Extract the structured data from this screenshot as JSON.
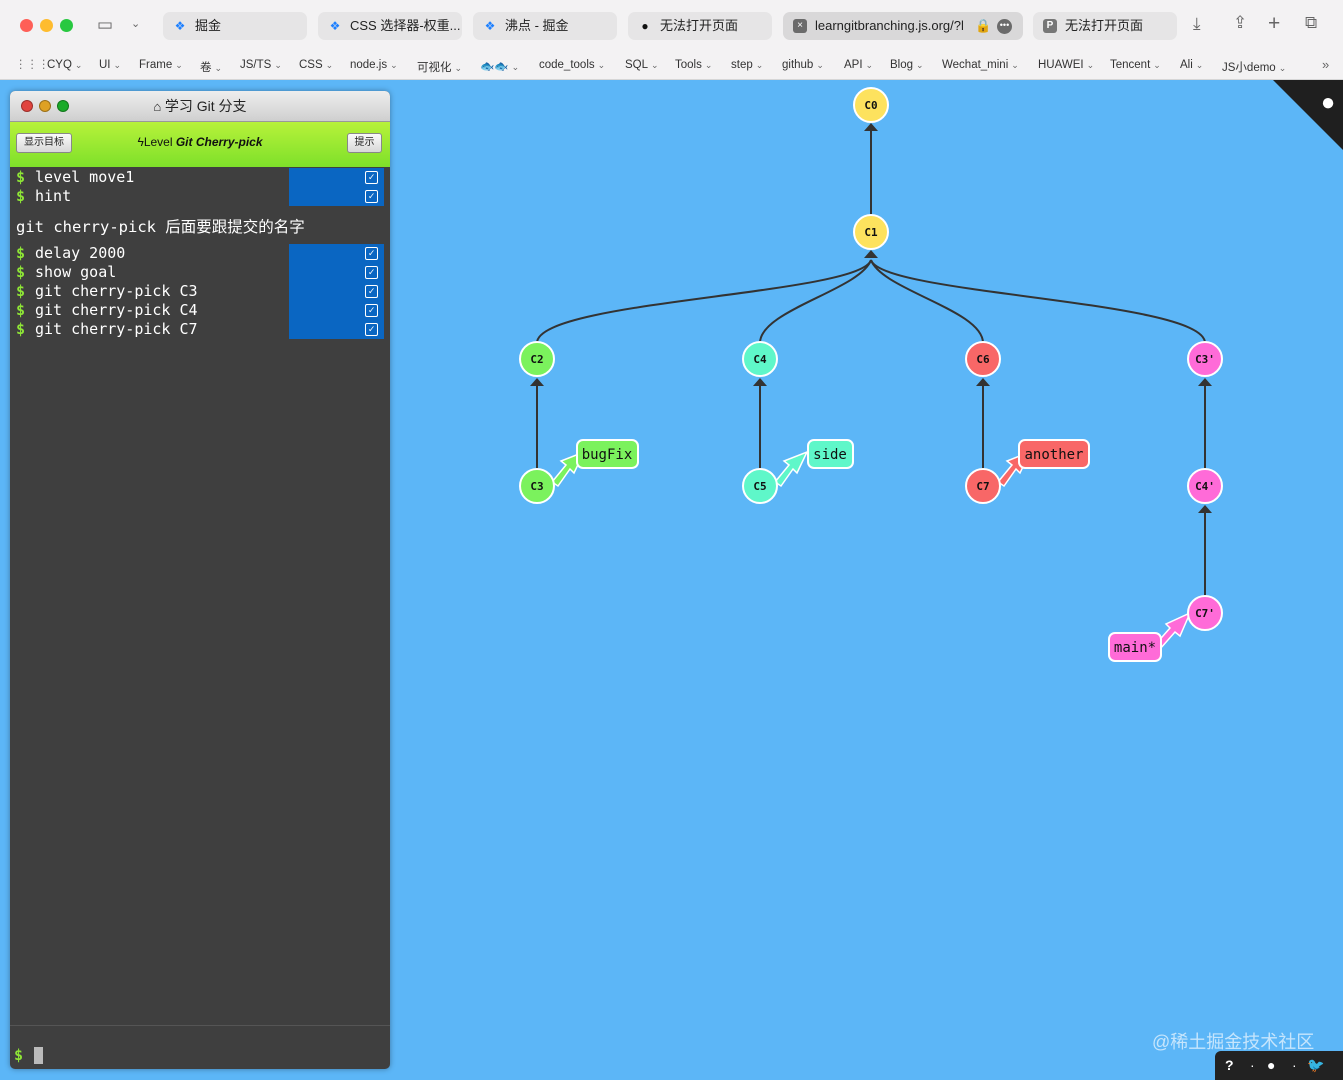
{
  "browser": {
    "tabs": [
      {
        "icon": "juejin-icon",
        "label": "掘金"
      },
      {
        "icon": "juejin-icon",
        "label": "CSS 选择器-权重..."
      },
      {
        "icon": "juejin-icon",
        "label": "沸点 - 掘金"
      },
      {
        "icon": "github-icon",
        "label": "无法打开页面"
      },
      {
        "icon": "close-icon",
        "label": "learngitbranching.js.org/?l"
      },
      {
        "icon": "p-icon",
        "label": "无法打开页面"
      }
    ],
    "bookmarks": [
      "CYQ",
      "UI",
      "Frame",
      "卷",
      "JS/TS",
      "CSS",
      "node.js",
      "可视化",
      "🐟🐟",
      "code_tools",
      "SQL",
      "Tools",
      "step",
      "github",
      "API",
      "Blog",
      "Wechat_mini",
      "HUAWEI",
      "Tencent",
      "Ali",
      "JS小demo"
    ]
  },
  "terminal": {
    "title": "学习 Git 分支",
    "show_goal": "显示目标",
    "hint": "提示",
    "level_prefix": "Level ",
    "level_name": "Git Cherry-pick",
    "commands_top": [
      {
        "dollar": "$",
        "text": "level move1"
      },
      {
        "dollar": "$",
        "text": "hint"
      }
    ],
    "message": "git cherry-pick 后面要跟提交的名字",
    "commands_bottom": [
      {
        "dollar": "$",
        "text": "delay 2000"
      },
      {
        "dollar": "$",
        "text": "show goal"
      },
      {
        "dollar": "$",
        "text": "git cherry-pick C3"
      },
      {
        "dollar": "$",
        "text": "git cherry-pick C4"
      },
      {
        "dollar": "$",
        "text": "git cherry-pick C7"
      }
    ],
    "prompt": "$"
  },
  "graph": {
    "commits": [
      "C0",
      "C1",
      "C2",
      "C3",
      "C4",
      "C5",
      "C6",
      "C7",
      "C3'",
      "C4'",
      "C7'"
    ],
    "branches": [
      "bugFix",
      "side",
      "another",
      "main*"
    ],
    "colors": {
      "yellow": "#fde25e",
      "green": "#7bf25d",
      "teal": "#5ff7c9",
      "red": "#f86767",
      "pink": "#ff6bd8",
      "bg": "#5cb6f7"
    }
  },
  "watermark": "@稀土掘金技术社区",
  "helpbar": [
    "?",
    "·",
    "●",
    "·",
    "🐦"
  ]
}
